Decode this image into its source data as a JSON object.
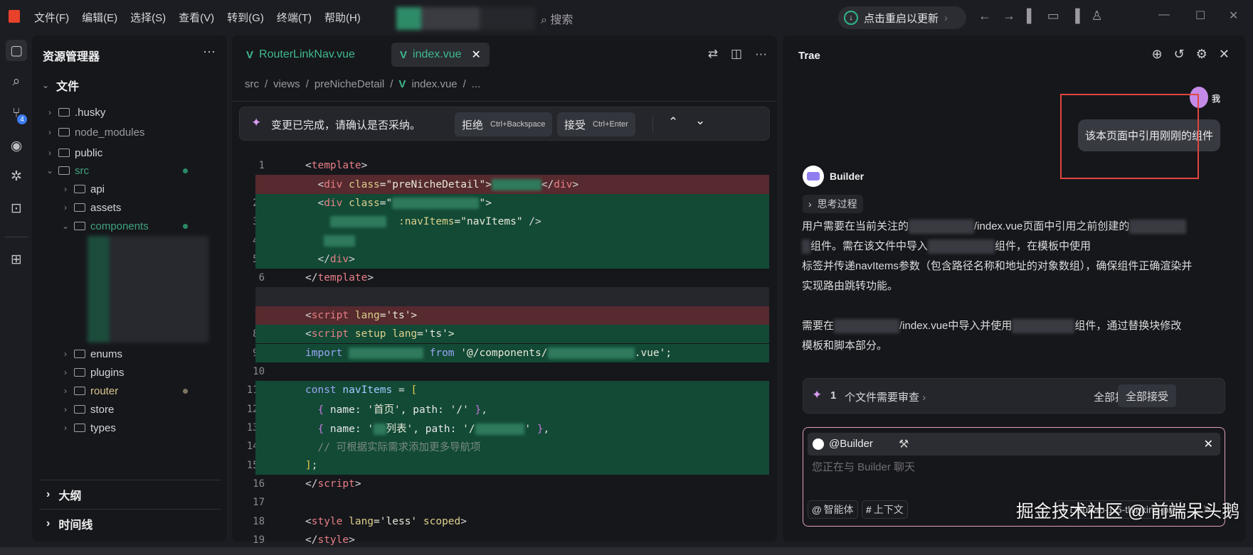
{
  "titlebar": {
    "menu": [
      "文件(F)",
      "编辑(E)",
      "选择(S)",
      "查看(V)",
      "转到(G)",
      "终端(T)",
      "帮助(H)"
    ],
    "search": "搜索",
    "update": "点击重启以更新"
  },
  "activity": {
    "scm_badge": "4"
  },
  "sidebar": {
    "title": "资源管理器",
    "more": "···",
    "root": "文件",
    "items": [
      ".husky",
      "node_modules",
      "public",
      "src",
      "api",
      "assets",
      "components",
      "enums",
      "plugins",
      "router",
      "store",
      "types"
    ],
    "outline": "大纲",
    "timeline": "时间线"
  },
  "editor": {
    "tabs": [
      "RouterLinkNav.vue",
      "index.vue"
    ],
    "breadcrumb": [
      "src",
      "views",
      "preNicheDetail",
      "index.vue",
      "..."
    ],
    "diffbar": {
      "message": "变更已完成，请确认是否采纳。",
      "reject": "拒绝",
      "reject_key": "Ctrl+Backspace",
      "accept": "接受",
      "accept_key": "Ctrl+Enter"
    },
    "lines": [
      {
        "n": "1",
        "k": "",
        "tokens": [
          [
            "<",
            "pun"
          ],
          [
            "template",
            "tag"
          ],
          [
            ">",
            "pun"
          ]
        ]
      },
      {
        "n": "−",
        "k": "del",
        "tokens": [
          [
            "  <",
            "pun"
          ],
          [
            "div",
            "tag"
          ],
          [
            " class",
            "attr"
          ],
          [
            "=\"preNicheDetail\">",
            "str"
          ],
          [
            "        ",
            "blur"
          ],
          [
            "</",
            "pun"
          ],
          [
            "div",
            "tag"
          ],
          [
            ">",
            "pun"
          ]
        ]
      },
      {
        "n": "2+",
        "k": "add",
        "tokens": [
          [
            "  <",
            "pun"
          ],
          [
            "div",
            "tag"
          ],
          [
            " class",
            "attr"
          ],
          [
            "=\"",
            "str"
          ],
          [
            "              ",
            "blur"
          ],
          [
            "\">",
            "str"
          ]
        ]
      },
      {
        "n": "3+",
        "k": "add",
        "tokens": [
          [
            "    ",
            "pun"
          ],
          [
            "         ",
            "blur"
          ],
          [
            "  :navItems",
            "attr"
          ],
          [
            "=\"navItems\"",
            "str"
          ],
          [
            " />",
            "pun"
          ]
        ]
      },
      {
        "n": "4+",
        "k": "add",
        "tokens": [
          [
            "   ",
            "pun"
          ],
          [
            "     ",
            "blur"
          ]
        ]
      },
      {
        "n": "5+",
        "k": "add",
        "tokens": [
          [
            "  </",
            "pun"
          ],
          [
            "div",
            "tag"
          ],
          [
            ">",
            "pun"
          ]
        ]
      },
      {
        "n": "6",
        "k": "",
        "tokens": [
          [
            "</",
            "pun"
          ],
          [
            "template",
            "tag"
          ],
          [
            ">",
            "pun"
          ]
        ]
      },
      {
        "n": "7",
        "k": "cur",
        "tokens": []
      },
      {
        "n": "−",
        "k": "del",
        "tokens": [
          [
            "<",
            "pun"
          ],
          [
            "script",
            "tag"
          ],
          [
            " lang",
            "attr"
          ],
          [
            "='ts'>",
            "str"
          ]
        ]
      },
      {
        "n": "8+",
        "k": "add",
        "tokens": [
          [
            "<",
            "pun"
          ],
          [
            "script",
            "tag"
          ],
          [
            " setup",
            "attr"
          ],
          [
            " lang",
            "attr"
          ],
          [
            "='ts'>",
            "str"
          ]
        ]
      },
      {
        "n": "9+",
        "k": "add",
        "tokens": [
          [
            "import",
            "kw"
          ],
          [
            " ",
            "pun"
          ],
          [
            "            ",
            "blur"
          ],
          [
            " from",
            "kw"
          ],
          [
            " '@/components/",
            "str"
          ],
          [
            "              ",
            "blur"
          ],
          [
            ".vue';",
            "str"
          ]
        ]
      },
      {
        "n": "10",
        "k": "",
        "tokens": []
      },
      {
        "n": "11+",
        "k": "add",
        "tokens": [
          [
            "const",
            "kw"
          ],
          [
            " navItems",
            "var"
          ],
          [
            " = ",
            "pun"
          ],
          [
            "[",
            "br"
          ]
        ]
      },
      {
        "n": "12+",
        "k": "add",
        "tokens": [
          [
            "  {",
            "br2"
          ],
          [
            " name: ",
            "key"
          ],
          [
            "'首页'",
            "str"
          ],
          [
            ", path: ",
            "key"
          ],
          [
            "'/'",
            "str"
          ],
          [
            " }",
            "br2"
          ],
          [
            ",",
            "pun"
          ]
        ]
      },
      {
        "n": "13+",
        "k": "add",
        "tokens": [
          [
            "  {",
            "br2"
          ],
          [
            " name: ",
            "key"
          ],
          [
            "'",
            "str"
          ],
          [
            "  ",
            "blur"
          ],
          [
            "列表'",
            "str"
          ],
          [
            ", path: ",
            "key"
          ],
          [
            "'/",
            "str"
          ],
          [
            "        ",
            "blur"
          ],
          [
            "'",
            "str"
          ],
          [
            " }",
            "br2"
          ],
          [
            ",",
            "pun"
          ]
        ]
      },
      {
        "n": "14+",
        "k": "add",
        "tokens": [
          [
            "  // 可根据实际需求添加更多导航项",
            "cm"
          ]
        ]
      },
      {
        "n": "15+",
        "k": "add",
        "tokens": [
          [
            "]",
            "br"
          ],
          [
            ";",
            "pun"
          ]
        ]
      },
      {
        "n": "16",
        "k": "",
        "tokens": [
          [
            "</",
            "pun"
          ],
          [
            "script",
            "tag"
          ],
          [
            ">",
            "pun"
          ]
        ]
      },
      {
        "n": "17",
        "k": "",
        "tokens": []
      },
      {
        "n": "18",
        "k": "",
        "tokens": [
          [
            "<",
            "pun"
          ],
          [
            "style",
            "tag"
          ],
          [
            " lang",
            "attr"
          ],
          [
            "='less'",
            "str"
          ],
          [
            " scoped",
            "attr"
          ],
          [
            ">",
            "pun"
          ]
        ]
      },
      {
        "n": "19",
        "k": "",
        "tokens": [
          [
            "</",
            "pun"
          ],
          [
            "style",
            "tag"
          ],
          [
            ">",
            "pun"
          ]
        ]
      }
    ]
  },
  "chat": {
    "title": "Trae",
    "user_label": "我",
    "user_message": "该本页面中引用刚刚的组件",
    "agent": "Builder",
    "thinking": "思考过程",
    "p1a": "用户需要在当前关注的",
    "p1b": "/index.vue页面中引用之前创建的",
    "p1c": "组件。需在该文件中导入",
    "p1d": "组件，在模板中使用",
    "p1e": "标签并传递navItems参数（包含路径名称和地址的对象数组），确保组件正确渲染并",
    "p1f": "实现路由跳转功能。",
    "p2a": "需要在",
    "p2b": "/index.vue中导入并使用",
    "p2c": "组件，通过替换块修改",
    "p2d": "模板和脚本部分。",
    "review": {
      "count": "1",
      "text": "个文件需要审查",
      "reject_all": "全部拒绝",
      "accept_all": "全部接受"
    },
    "input": {
      "mention": "@Builder",
      "placeholder": "您正在与 Builder 聊天",
      "agent_btn": "智能体",
      "context_btn": "上下文",
      "model": "Doubao-1.5-thinking-pro"
    }
  },
  "watermark": "掘金技术社区 @ 前端呆头鹅"
}
